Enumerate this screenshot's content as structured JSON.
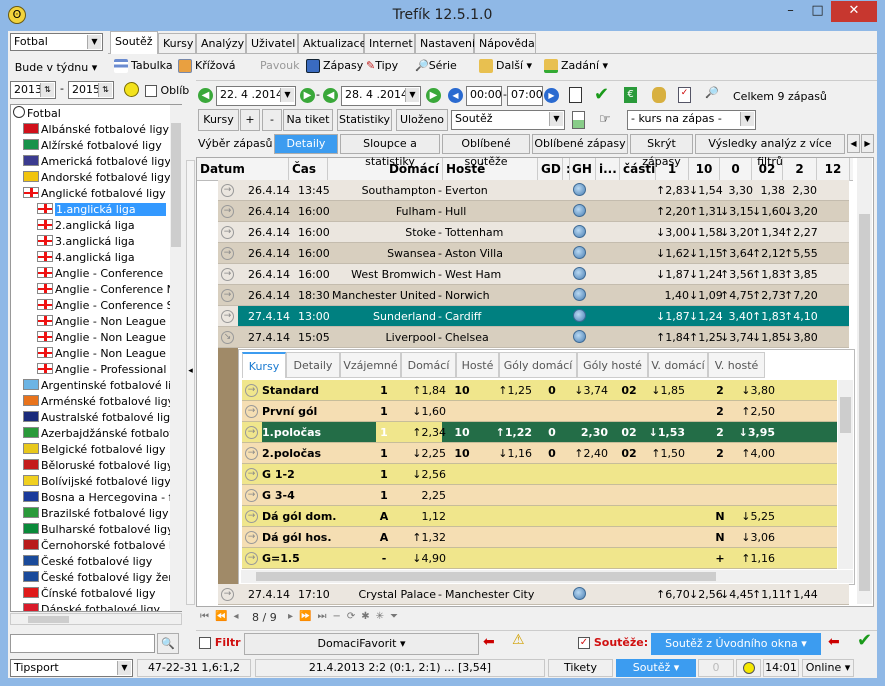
{
  "window": {
    "title": "Trefík 12.5.1.0",
    "minimize": "–",
    "maximize": "□",
    "close": "✕"
  },
  "left": {
    "sport_select": "Fotbal",
    "period_button": "Bude v týdnu ▾",
    "year_from": "2013",
    "year_to": "2015",
    "year_sep": "-",
    "oblibene_label": "Oblíb",
    "tree": [
      {
        "label": "Fotbal",
        "level": 0,
        "flag": "ball"
      },
      {
        "label": "Albánské fotbalové ligy",
        "level": 1,
        "flag": "#d0101a"
      },
      {
        "label": "Alžírské fotbalové ligy",
        "level": 1,
        "flag": "#17924a"
      },
      {
        "label": "Americká fotbalové ligy žen",
        "level": 1,
        "flag": "#3b3b8f"
      },
      {
        "label": "Andorské fotbalové ligy",
        "level": 1,
        "flag": "#f1c40f"
      },
      {
        "label": "Anglické fotbalové ligy",
        "level": 1,
        "flag": "eng"
      },
      {
        "label": "1.anglická liga",
        "level": 2,
        "flag": "eng",
        "selected": true
      },
      {
        "label": "2.anglická liga",
        "level": 2,
        "flag": "eng"
      },
      {
        "label": "3.anglická liga",
        "level": 2,
        "flag": "eng"
      },
      {
        "label": "4.anglická liga",
        "level": 2,
        "flag": "eng"
      },
      {
        "label": "Anglie - Conference",
        "level": 2,
        "flag": "eng"
      },
      {
        "label": "Anglie - Conference North",
        "level": 2,
        "flag": "eng"
      },
      {
        "label": "Anglie - Conference South",
        "level": 2,
        "flag": "eng"
      },
      {
        "label": "Anglie - Non League Premier",
        "level": 2,
        "flag": "eng"
      },
      {
        "label": "Anglie - Non League Premier",
        "level": 2,
        "flag": "eng"
      },
      {
        "label": "Anglie - Non League Premier",
        "level": 2,
        "flag": "eng"
      },
      {
        "label": "Anglie - Professional Development",
        "level": 2,
        "flag": "eng"
      },
      {
        "label": "Argentinské fotbalové ligy",
        "level": 1,
        "flag": "#6cb4e4"
      },
      {
        "label": "Arménské fotbalové ligy",
        "level": 1,
        "flag": "#e8731c"
      },
      {
        "label": "Australské fotbalové ligy",
        "level": 1,
        "flag": "#1a2a7a"
      },
      {
        "label": "Azerbajdžánské fotbalové ligy",
        "level": 1,
        "flag": "#2a9a3a"
      },
      {
        "label": "Belgické fotbalové ligy",
        "level": 1,
        "flag": "#e8c81c"
      },
      {
        "label": "Běloruské fotbalové ligy",
        "level": 1,
        "flag": "#c41c1c"
      },
      {
        "label": "Bolívijské fotbalové ligy",
        "level": 1,
        "flag": "#f0d020"
      },
      {
        "label": "Bosna a Hercegovina - fotbal",
        "level": 1,
        "flag": "#1a3a9a"
      },
      {
        "label": "Brazilské fotbalové ligy",
        "level": 1,
        "flag": "#2a9a3a"
      },
      {
        "label": "Bulharské fotbalové ligy",
        "level": 1,
        "flag": "#0a8a3a"
      },
      {
        "label": "Černohorské fotbalové ligy",
        "level": 1,
        "flag": "#b81a1a"
      },
      {
        "label": "České fotbalové ligy",
        "level": 1,
        "flag": "#1a4a9a"
      },
      {
        "label": "České fotbalové ligy žen",
        "level": 1,
        "flag": "#1a4a9a"
      },
      {
        "label": "Čínské fotbalové ligy",
        "level": 1,
        "flag": "#e01a1a"
      },
      {
        "label": "Dánské fotbalové ligy",
        "level": 1,
        "flag": "#d81a2a"
      }
    ],
    "search_input": "",
    "bookmaker_select": "Tipsport"
  },
  "menu_tabs": [
    "Soutěž",
    "Kursy",
    "Analýzy",
    "Uživatel",
    "Aktualizace",
    "Internet",
    "Nastavení",
    "Nápověda"
  ],
  "toolbar": {
    "tabulka": "Tabulka",
    "krizova": "Křížová",
    "pavouk": "Pavouk",
    "zapasy": "Zápasy",
    "tipy": "Tipy",
    "serie": "Série",
    "dalsi": "Další ▾",
    "zadani": "Zadání ▾"
  },
  "nav": {
    "date_from": "22. 4 .2014",
    "date_to": "28. 4 .2014",
    "time_from": "00:00",
    "time_to": "07:00",
    "dash": "-",
    "total": "Celkem 9 zápasů"
  },
  "buttons": {
    "kursy": "Kursy",
    "plus": "+",
    "minus": "-",
    "na_tiket": "Na tiket",
    "statistiky": "Statistiky",
    "ulozeno": "Uloženo",
    "competition_select": "Soutěž",
    "odds_select": "- kurs na zápas -"
  },
  "subtabs": {
    "vyber": "Výběr zápasů",
    "items": [
      "Detaily",
      "Sloupce a statistiky",
      "Oblíbené soutěže",
      "Oblíbené zápasy",
      "Skrýt zápasy",
      "Výsledky analýz z více filtrů"
    ]
  },
  "grid": {
    "headers": [
      "Datum",
      "Čas",
      "Domácí",
      "Hosté",
      "GD",
      ":",
      "GH",
      "i...",
      "části",
      "1",
      "10",
      "0",
      "02",
      "2",
      "12"
    ],
    "rows": [
      {
        "date": "26.4.14",
        "time": "13:45",
        "home": "Southampton",
        "away": "Everton",
        "odds": [
          "↑2,83",
          "↓1,54",
          "3,30",
          "1,38",
          "2,30"
        ]
      },
      {
        "date": "26.4.14",
        "time": "16:00",
        "home": "Fulham",
        "away": "Hull",
        "odds": [
          "↑2,20",
          "↑1,31",
          "↓3,15",
          "↓1,60",
          "↓3,20"
        ]
      },
      {
        "date": "26.4.14",
        "time": "16:00",
        "home": "Stoke",
        "away": "Tottenham",
        "odds": [
          "↓3,00",
          "↓1,58",
          "↓3,20",
          "↑1,34",
          "↑2,27"
        ]
      },
      {
        "date": "26.4.14",
        "time": "16:00",
        "home": "Swansea",
        "away": "Aston Villa",
        "odds": [
          "↓1,62",
          "↓1,15",
          "↑3,64",
          "↑2,12",
          "↑5,55"
        ]
      },
      {
        "date": "26.4.14",
        "time": "16:00",
        "home": "West Bromwich",
        "away": "West Ham",
        "odds": [
          "↓1,87",
          "↓1,24",
          "↑3,56",
          "↑1,83",
          "↑3,85"
        ]
      },
      {
        "date": "26.4.14",
        "time": "18:30",
        "home": "Manchester United",
        "away": "Norwich",
        "odds": [
          "1,40",
          "↓1,09",
          "↑4,75",
          "↑2,73",
          "↑7,20"
        ]
      },
      {
        "date": "27.4.14",
        "time": "13:00",
        "home": "Sunderland",
        "away": "Cardiff",
        "odds": [
          "↓1,87",
          "↓1,24",
          "3,40",
          "↑1,83",
          "↑4,10"
        ],
        "selected": true
      },
      {
        "date": "27.4.14",
        "time": "15:05",
        "home": "Liverpool",
        "away": "Chelsea",
        "odds": [
          "↑1,84",
          "↑1,25",
          "↓3,74",
          "↓1,85",
          "↓3,80"
        ],
        "expanded": true
      }
    ],
    "last_row": {
      "date": "27.4.14",
      "time": "17:10",
      "home": "Crystal Palace",
      "away": "Manchester City",
      "odds": [
        "↑6,70",
        "↓2,56",
        "↓4,45",
        "↑1,11",
        "↑1,44"
      ]
    },
    "pager": "8 / 9"
  },
  "detail": {
    "tabs": [
      "Kursy",
      "Detaily",
      "Vzájemné",
      "Domácí",
      "Hosté",
      "Góly domácí",
      "Góly hosté",
      "V. domácí",
      "V. hosté"
    ],
    "rows": [
      {
        "name": "Standard",
        "cells": [
          "1",
          "↑1,84",
          "10",
          "↑1,25",
          "0",
          "↓3,74",
          "02",
          "↓1,85",
          "2",
          "↓3,80"
        ]
      },
      {
        "name": "První gól",
        "cells": [
          "1",
          "↓1,60",
          "",
          "",
          "",
          "",
          "",
          "",
          "2",
          "↑2,50"
        ]
      },
      {
        "name": "1.poločas",
        "cells": [
          "1",
          "↑2,34",
          "10",
          "↑1,22",
          "0",
          "2,30",
          "02",
          "↓1,53",
          "2",
          "↓3,95"
        ],
        "selected": true
      },
      {
        "name": "2.poločas",
        "cells": [
          "1",
          "↓2,25",
          "10",
          "↓1,16",
          "0",
          "↑2,40",
          "02",
          "↑1,50",
          "2",
          "↑4,00"
        ]
      },
      {
        "name": "G 1-2",
        "cells": [
          "1",
          "↓2,56",
          "",
          "",
          "",
          "",
          "",
          "",
          "",
          ""
        ]
      },
      {
        "name": "G 3-4",
        "cells": [
          "1",
          "2,25",
          "",
          "",
          "",
          "",
          "",
          "",
          "",
          ""
        ]
      },
      {
        "name": "Dá gól dom.",
        "cells": [
          "A",
          "1,12",
          "",
          "",
          "",
          "",
          "",
          "",
          "N",
          "↓5,25"
        ]
      },
      {
        "name": "Dá gól hos.",
        "cells": [
          "A",
          "↑1,32",
          "",
          "",
          "",
          "",
          "",
          "",
          "N",
          "↓3,06"
        ]
      },
      {
        "name": "G=1.5",
        "cells": [
          "-",
          "↓4,90",
          "",
          "",
          "",
          "",
          "",
          "",
          "+",
          "↑1,16"
        ]
      }
    ]
  },
  "filterbar": {
    "filtr": "Filtr",
    "favorit": "DomaciFavorit ▾",
    "souteze_label": "Soutěže:",
    "souteze_button": "Soutěž z Úvodního okna ▾"
  },
  "status": {
    "score": "47-22-31  1,6:1,2",
    "last_match": "21.4.2013 2:2 (0:1, 2:1) ... [3,54]",
    "tikety": "Tikety",
    "soutez": "Soutěž ▾",
    "count": "0",
    "time": "14:01",
    "online": "Online ▾"
  },
  "colors": {
    "selected_row": "#008080",
    "row_light": "#ebe6df",
    "row_dark": "#d8cfbf",
    "detail_yellow": "#f0e68c",
    "detail_tan": "#f5deb3",
    "detail_selected": "#236d47",
    "accent_blue": "#3c9cf0",
    "filter_red": "#d01010"
  }
}
